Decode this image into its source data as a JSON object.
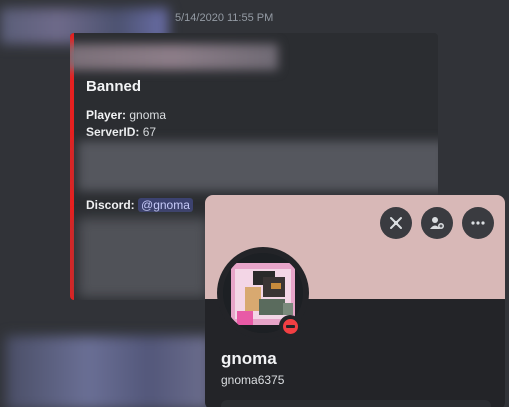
{
  "message": {
    "timestamp": "5/14/2020 11:55 PM"
  },
  "embed": {
    "title": "Banned",
    "accent_color": "#e62020",
    "fields": {
      "player_label": "Player:",
      "player_value": "gnoma",
      "server_label": "ServerID:",
      "server_value": "67",
      "discord_label": "Discord:",
      "discord_mention": "@gnoma"
    }
  },
  "profile": {
    "banner_color": "#d8b8b7",
    "display_name": "gnoma",
    "username": "gnoma6375",
    "status": "dnd",
    "status_color": "#f23f43",
    "buttons": {
      "gift": "gift-nitro-icon",
      "add_friend": "add-friend-icon",
      "more": "more-options-icon"
    }
  }
}
